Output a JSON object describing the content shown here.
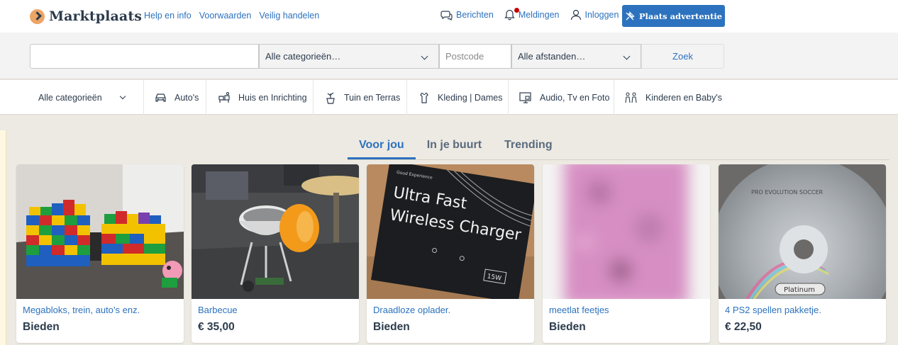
{
  "header": {
    "logo_text": "Marktplaats",
    "links": [
      "Help en info",
      "Voorwaarden",
      "Veilig handelen"
    ],
    "messages_label": "Berichten",
    "notifications_label": "Meldingen",
    "login_label": "Inloggen",
    "place_ad_label": "Plaats advertentie"
  },
  "search": {
    "query_value": "",
    "category_value": "Alle categorieën…",
    "postcode_placeholder": "Postcode",
    "distance_value": "Alle afstanden…",
    "submit_label": "Zoek"
  },
  "categories": {
    "all_label": "Alle categorieën",
    "items": [
      {
        "label": "Auto's",
        "icon": "car-icon"
      },
      {
        "label": "Huis en Inrichting",
        "icon": "furniture-icon"
      },
      {
        "label": "Tuin en Terras",
        "icon": "plant-icon"
      },
      {
        "label": "Kleding | Dames",
        "icon": "clothing-icon"
      },
      {
        "label": "Audio, Tv en Foto",
        "icon": "monitor-icon"
      },
      {
        "label": "Kinderen en Baby's",
        "icon": "kids-icon"
      }
    ]
  },
  "feed": {
    "tabs": [
      {
        "label": "Voor jou",
        "active": true
      },
      {
        "label": "In je buurt",
        "active": false
      },
      {
        "label": "Trending",
        "active": false
      }
    ],
    "listings": [
      {
        "title": "Megabloks, trein, auto’s enz.",
        "price": "Bieden"
      },
      {
        "title": "Barbecue",
        "price": "€ 35,00"
      },
      {
        "title": "Draadloze oplader.",
        "price": "Bieden"
      },
      {
        "title": "meetlat feetjes",
        "price": "Bieden"
      },
      {
        "title": "4 PS2 spellen pakketje.",
        "price": "€ 22,50"
      }
    ],
    "image_texts": {
      "charger_line1": "Ultra Fast",
      "charger_line2": "Wireless Charger",
      "charger_badge": "15W",
      "charger_brand": "Good Experience",
      "disc_label": "Platinum",
      "disc_title": "PRO EVOLUTION SOCCER"
    }
  },
  "colors": {
    "brand_blue": "#2c72be",
    "logo_orange": "#eda566",
    "text_dark": "#2d3c4d",
    "page_bg": "#edeae3",
    "notification_dot": "#c90000"
  }
}
